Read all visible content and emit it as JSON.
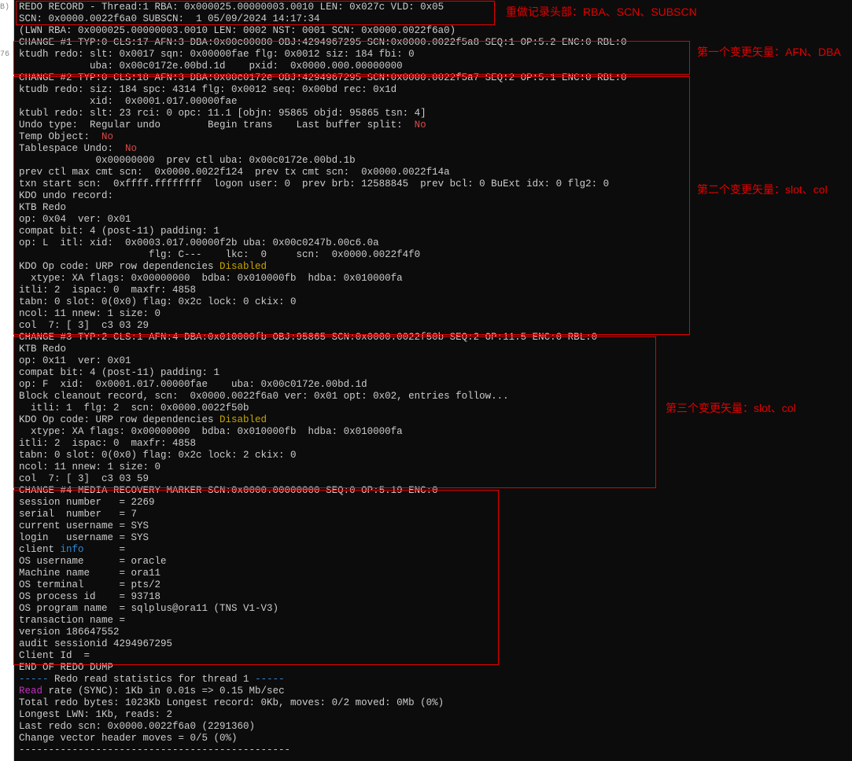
{
  "gutter": {
    "b": "B)",
    "n76": "76",
    "v": "",
    "arrows": ">>"
  },
  "terminal": {
    "header": [
      "REDO RECORD - Thread:1 RBA: 0x000025.00000003.0010 LEN: 0x027c VLD: 0x05",
      "SCN: 0x0000.0022f6a0 SUBSCN:  1 05/09/2024 14:17:34",
      "(LWN RBA: 0x000025.00000003.0010 LEN: 0002 NST: 0001 SCN: 0x0000.0022f6a0)"
    ],
    "change1": [
      "CHANGE #1 TYP:0 CLS:17 AFN:3 DBA:0x00c00080 OBJ:4294967295 SCN:0x0000.0022f5a8 SEQ:1 OP:5.2 ENC:0 RBL:0",
      "ktudh redo: slt: 0x0017 sqn: 0x00000fae flg: 0x0012 siz: 184 fbi: 0",
      "            uba: 0x00c0172e.00bd.1d    pxid:  0x0000.000.00000000"
    ],
    "change2_pre": [
      "CHANGE #2 TYP:0 CLS:18 AFN:3 DBA:0x00c0172e OBJ:4294967295 SCN:0x0000.0022f5a7 SEQ:2 OP:5.1 ENC:0 RBL:0",
      "ktudb redo: siz: 184 spc: 4314 flg: 0x0012 seq: 0x00bd rec: 0x1d",
      "            xid:  0x0001.017.00000fae  ",
      "ktubl redo: slt: 23 rci: 0 opc: 11.1 [objn: 95865 objd: 95865 tsn: 4]"
    ],
    "change2_undo_line": {
      "pre": "Undo type:  Regular undo        Begin trans    Last buffer split:  ",
      "no": "No"
    },
    "change2_temp_line": {
      "pre": "Temp Object:  ",
      "no": "No"
    },
    "change2_ts_line": {
      "pre": "Tablespace Undo:  ",
      "no": "No"
    },
    "change2_mid": [
      "             0x00000000  prev ctl uba: 0x00c0172e.00bd.1b ",
      "prev ctl max cmt scn:  0x0000.0022f124  prev tx cmt scn:  0x0000.0022f14a ",
      "txn start scn:  0xffff.ffffffff  logon user: 0  prev brb: 12588845  prev bcl: 0 BuExt idx: 0 flg2: 0",
      "KDO undo record:",
      "KTB Redo ",
      "op: 0x04  ver: 0x01  ",
      "compat bit: 4 (post-11) padding: 1",
      "op: L  itl: xid:  0x0003.017.00000f2b uba: 0x00c0247b.00c6.0a",
      "                      flg: C---    lkc:  0     scn:  0x0000.0022f4f0"
    ],
    "change2_kdo_line": {
      "pre": "KDO Op code: URP row dependencies ",
      "disabled": "Disabled"
    },
    "change2_post": [
      "  xtype: XA flags: 0x00000000  bdba: 0x010000fb  hdba: 0x010000fa",
      "itli: 2  ispac: 0  maxfr: 4858",
      "tabn: 0 slot: 0(0x0) flag: 0x2c lock: 0 ckix: 0",
      "ncol: 11 nnew: 1 size: 0",
      "col  7: [ 3]  c3 03 29"
    ],
    "change3_pre": [
      "CHANGE #3 TYP:2 CLS:1 AFN:4 DBA:0x010000fb OBJ:95865 SCN:0x0000.0022f50b SEQ:2 OP:11.5 ENC:0 RBL:0",
      "KTB Redo ",
      "op: 0x11  ver: 0x01  ",
      "compat bit: 4 (post-11) padding: 1",
      "op: F  xid:  0x0001.017.00000fae    uba: 0x00c0172e.00bd.1d",
      "Block cleanout record, scn:  0x0000.0022f6a0 ver: 0x01 opt: 0x02, entries follow...",
      "  itli: 1  flg: 2  scn: 0x0000.0022f50b"
    ],
    "change3_kdo_line": {
      "pre": "KDO Op code: URP row dependencies ",
      "disabled": "Disabled"
    },
    "change3_post": [
      "  xtype: XA flags: 0x00000000  bdba: 0x010000fb  hdba: 0x010000fa",
      "itli: 2  ispac: 0  maxfr: 4858",
      "tabn: 0 slot: 0(0x0) flag: 0x2c lock: 2 ckix: 0",
      "ncol: 11 nnew: 1 size: 0",
      "col  7: [ 3]  c3 03 59"
    ],
    "change4_pre": [
      "CHANGE #4 MEDIA RECOVERY MARKER SCN:0x0000.00000000 SEQ:0 OP:5.19 ENC:0",
      "session number   = 2269",
      "serial  number   = 7",
      "current username = SYS",
      "login   username = SYS"
    ],
    "change4_client_line": {
      "pre": "client ",
      "info": "info",
      "post": "      ="
    },
    "change4_post": [
      "OS username      = oracle",
      "Machine name     = ora11",
      "OS terminal      = pts/2",
      "OS process id    = 93718",
      "OS program name  = sqlplus@ora11 (TNS V1-V3)",
      "transaction name = ",
      "version 186647552",
      "audit sessionid 4294967295",
      "Client Id  = "
    ],
    "footer_end": "END OF REDO DUMP",
    "footer_stats_line": {
      "d1": "-----",
      "mid": " Redo read statistics for thread 1 ",
      "d2": "-----"
    },
    "footer_read_line": {
      "read": "Read",
      "rest": " rate (SYNC): 1Kb in 0.01s => 0.15 Mb/sec"
    },
    "footer_rest": [
      "Total redo bytes: 1023Kb Longest record: 0Kb, moves: 0/2 moved: 0Mb (0%)",
      "Longest LWN: 1Kb, reads: 2",
      "Last redo scn: 0x0000.0022f6a0 (2291360)",
      "Change vector header moves = 0/5 (0%)",
      "----------------------------------------------"
    ]
  },
  "annotations": {
    "a1": "重做记录头部：RBA、SCN、SUBSCN",
    "a2": "第一个变更矢量：AFN、DBA",
    "a3": "第二个变更矢量：slot、col",
    "a4": "第三个变更矢量：slot、col"
  }
}
